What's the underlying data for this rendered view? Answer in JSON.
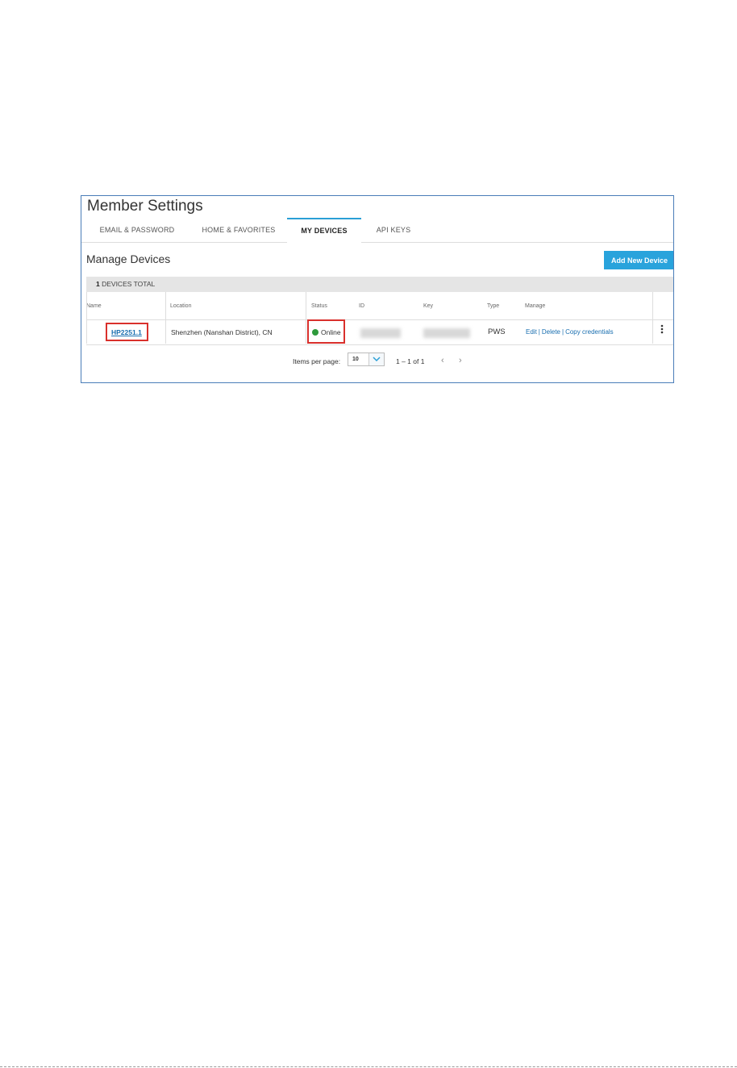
{
  "page": {
    "title": "Member Settings"
  },
  "tabs": [
    {
      "label": "EMAIL & PASSWORD",
      "active": false
    },
    {
      "label": "HOME & FAVORITES",
      "active": false
    },
    {
      "label": "MY DEVICES",
      "active": true
    },
    {
      "label": "API KEYS",
      "active": false
    }
  ],
  "section": {
    "title": "Manage Devices",
    "add_button": "Add New Device"
  },
  "summary": {
    "count": "1",
    "label": " DEVICES TOTAL"
  },
  "table": {
    "headers": {
      "name": "Name",
      "location": "Location",
      "status": "Status",
      "id": "ID",
      "key": "Key",
      "type": "Type",
      "manage": "Manage"
    },
    "rows": [
      {
        "name": "HP2251.1",
        "location": "Shenzhen (Nanshan District), CN",
        "status": "Online",
        "type": "PWS",
        "actions": {
          "edit": "Edit",
          "delete": "Delete",
          "copy": "Copy credentials",
          "separator": "|"
        }
      }
    ]
  },
  "pagination": {
    "items_per_page_label": "Items per page:",
    "items_per_page_value": "10",
    "range": "1 – 1 of 1",
    "prev": "‹",
    "next": "›"
  },
  "colors": {
    "accent": "#29a3dc",
    "link": "#1a6fb0",
    "highlight": "#d9302c",
    "online": "#2e9a3c"
  }
}
